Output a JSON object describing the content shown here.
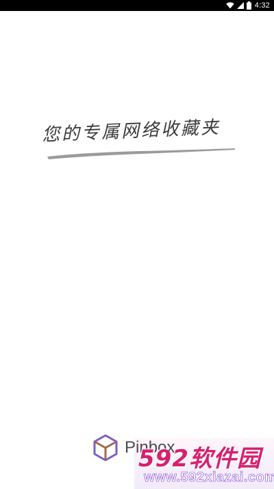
{
  "status_bar": {
    "time": "4:32",
    "icons": [
      "wifi-icon",
      "signal-icon",
      "battery-icon"
    ]
  },
  "splash": {
    "tagline": "您的专属网络收藏夹",
    "logo_name": "Pinbox",
    "logo_color": "#7a5cc8"
  },
  "watermark": {
    "main": "592软件园",
    "url": "www.592xiazai.com",
    "accent": "#d81f6f"
  }
}
